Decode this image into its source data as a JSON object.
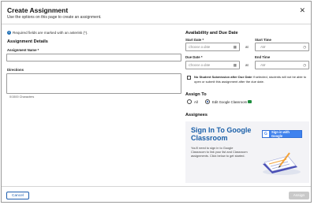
{
  "dialog": {
    "title": "Create Assignment",
    "subtitle": "Use the options on this page to create an assignment.",
    "required_note": "Required fields are marked with an asterisk (*)."
  },
  "details": {
    "heading": "Assignment Details",
    "name_label": "Assignment Name *",
    "name_value": "",
    "directions_label": "Directions",
    "directions_value": "",
    "char_count": "0/1500 Characters"
  },
  "availability": {
    "heading": "Availability and Due Date",
    "start_date_label": "Start Date *",
    "start_date_placeholder": "Choose a date",
    "start_time_label": "Start Time",
    "start_time_placeholder": "AM",
    "due_date_label": "Due Date *",
    "due_date_placeholder": "Choose a date",
    "end_time_label": "End Time",
    "end_time_placeholder": "AM",
    "between_word": "at",
    "no_late_label": "No Student Submission after Due Date",
    "no_late_desc": "If selected, students will not be able to open or submit this assignment after the due date."
  },
  "assign_to": {
    "heading": "Assign To",
    "options": [
      "All",
      "Edit Google Classroom"
    ],
    "selected_index": 1
  },
  "assignees": {
    "heading": "Assignees",
    "panel_title": "Sign In To Google Classroom",
    "panel_desc": "You'll need to sign in to Google Classroom to link your list and Classroom assignments. Click below to get started.",
    "signin_button": "Sign in with Google"
  },
  "footer": {
    "cancel": "Cancel",
    "assign": "Assign"
  },
  "colors": {
    "accent": "#1f5fb0",
    "google_blue": "#3f82ee",
    "disabled": "#c9c9c9"
  }
}
